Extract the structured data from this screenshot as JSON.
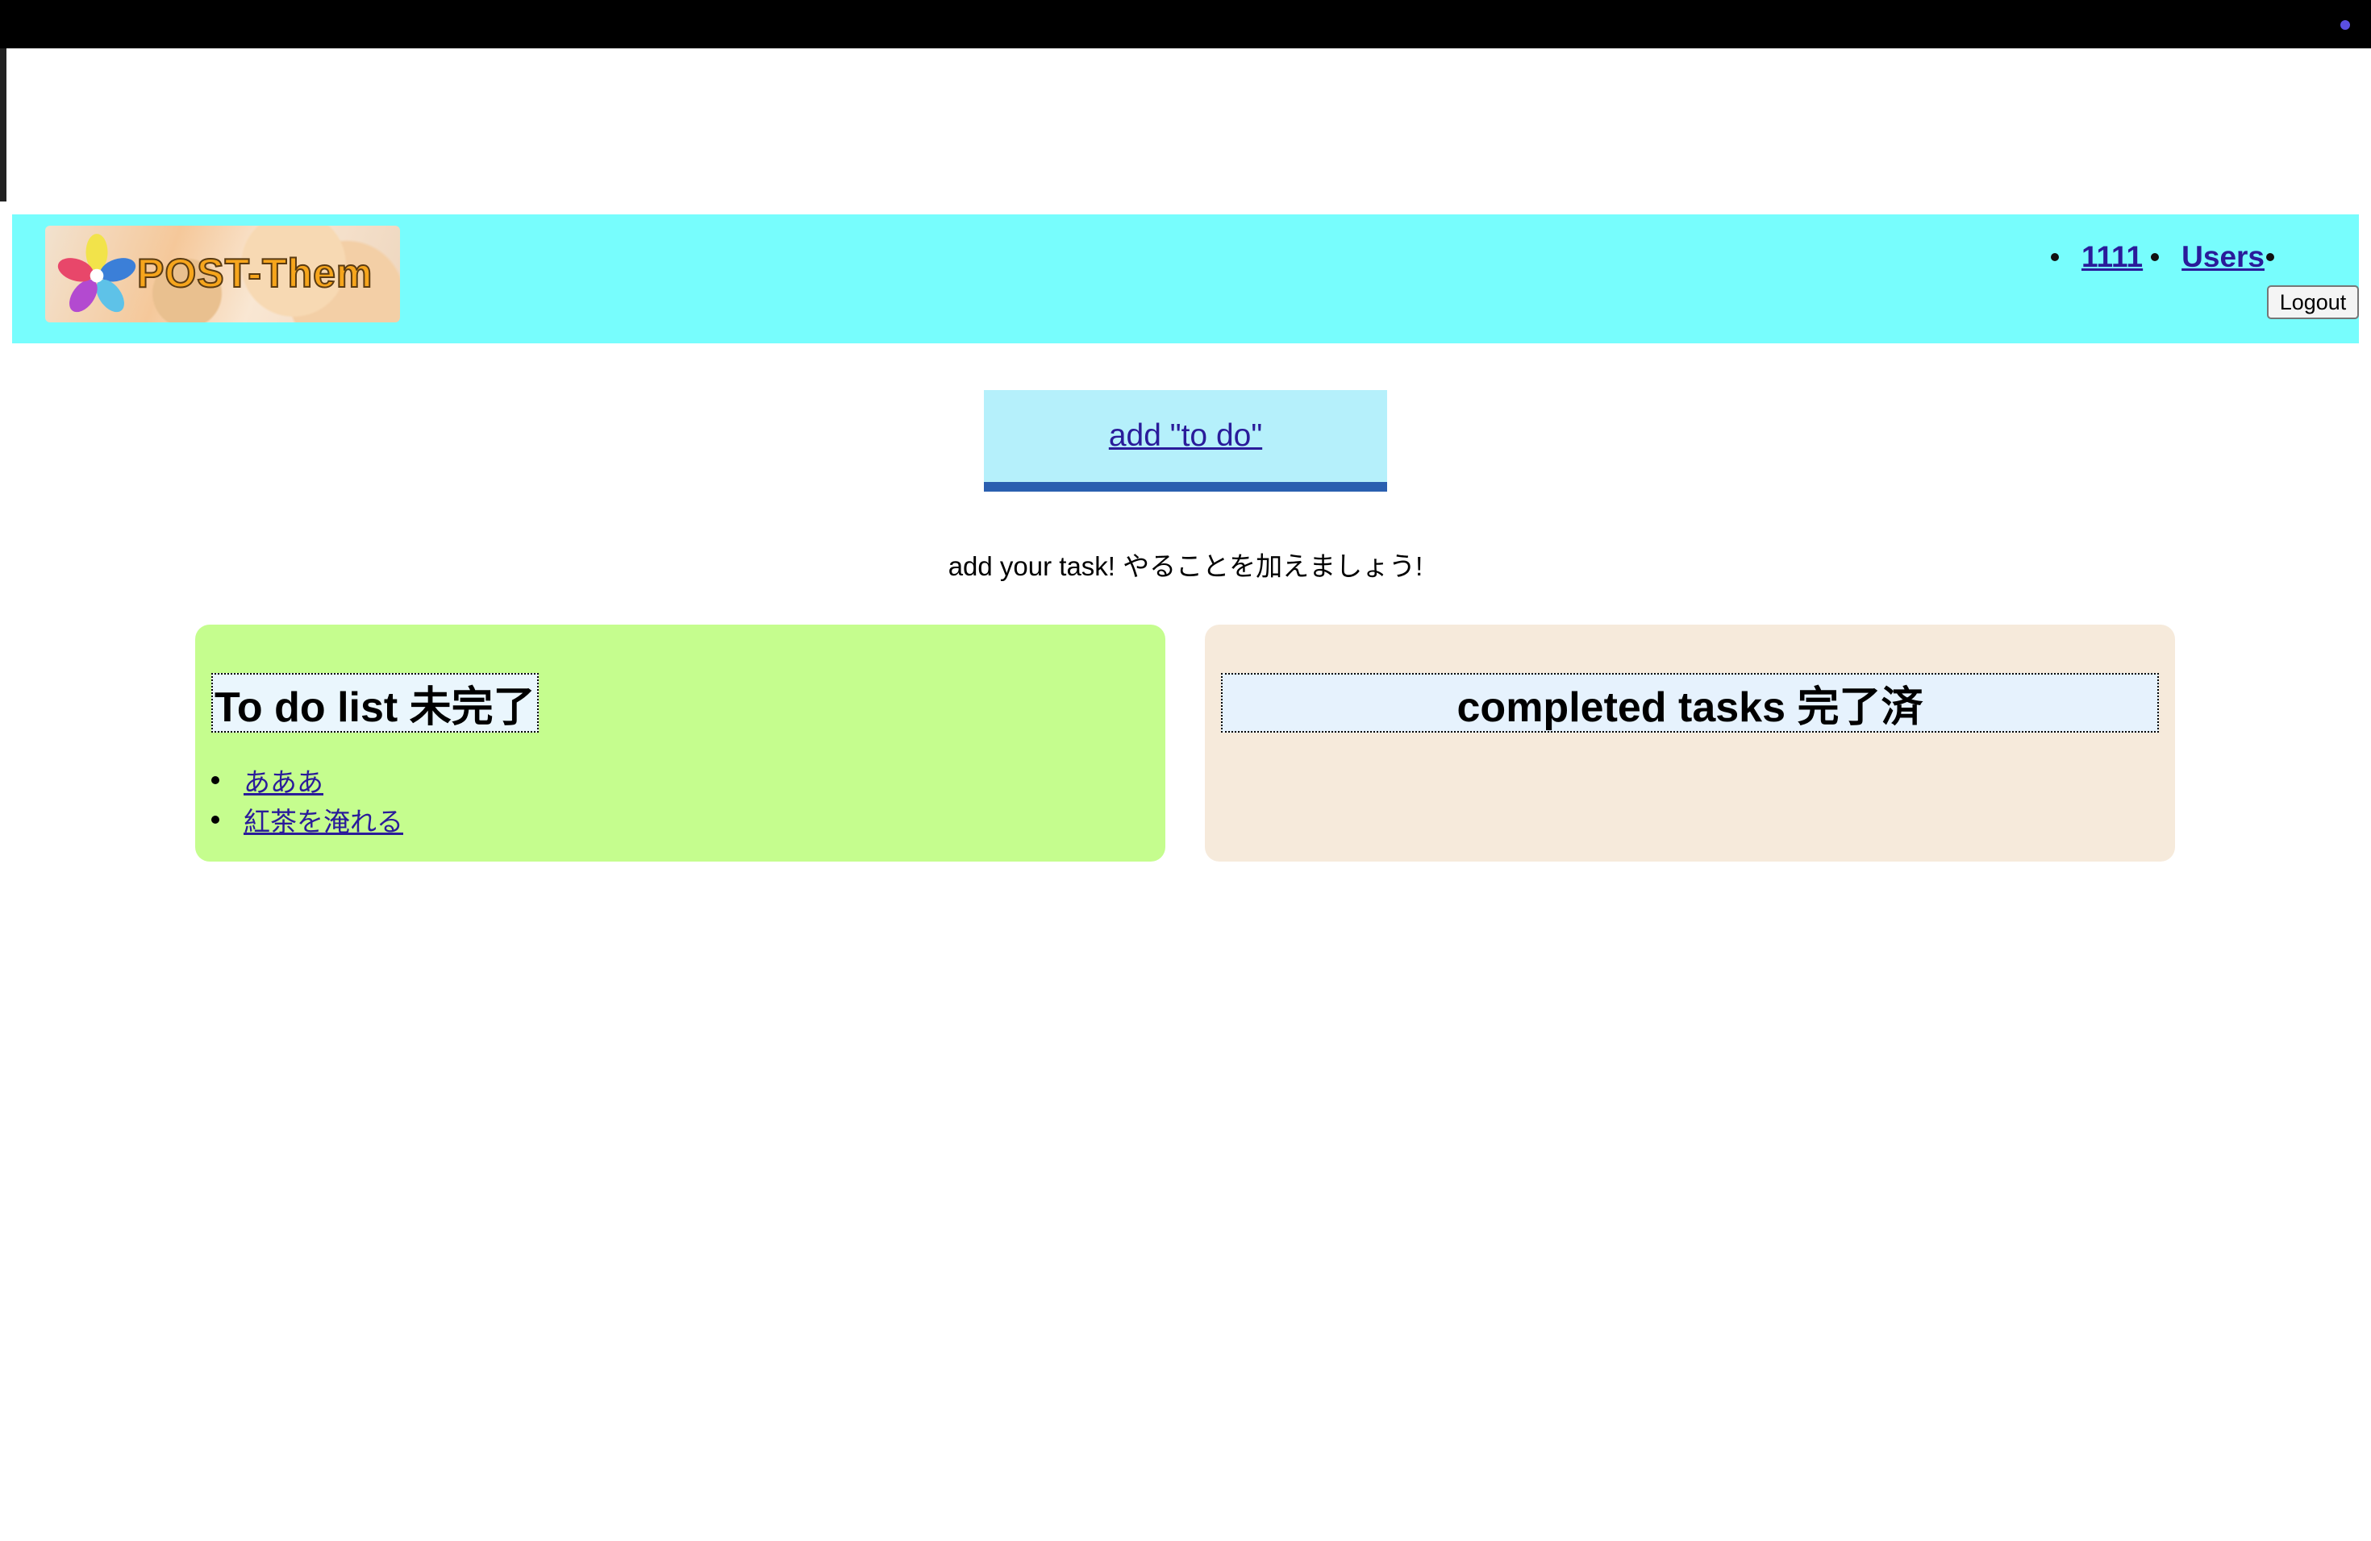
{
  "colors": {
    "header_bg": "#77fdfd",
    "link": "#2a1b9a",
    "todo_panel_bg": "#c5fd8e",
    "done_panel_bg": "#f6eadb",
    "add_button_bg": "#b5f0fb",
    "add_button_border": "#2a5fb0"
  },
  "header": {
    "logo_text": "POST-Them",
    "nav": [
      {
        "label": "1111"
      },
      {
        "label": "Users"
      }
    ],
    "logout_label": "Logout"
  },
  "main": {
    "add_button_label": "add \"to do\"",
    "subtitle": "add your task! やることを加えましょう!",
    "todo_panel": {
      "title": "To do list 未完了",
      "items": [
        "あああ",
        "紅茶を淹れる"
      ]
    },
    "done_panel": {
      "title": "completed tasks 完了済",
      "items": []
    }
  }
}
